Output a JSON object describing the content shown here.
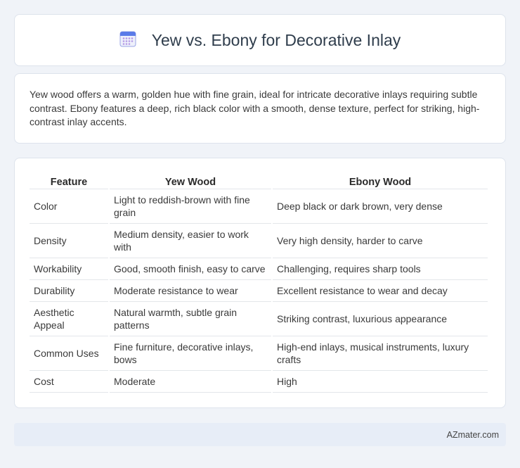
{
  "header": {
    "icon": "calendar-icon",
    "title": "Yew vs. Ebony for Decorative Inlay"
  },
  "intro": {
    "text": "Yew wood offers a warm, golden hue with fine grain, ideal for intricate decorative inlays requiring subtle contrast. Ebony features a deep, rich black color with a smooth, dense texture, perfect for striking, high-contrast inlay accents."
  },
  "table": {
    "headers": [
      "Feature",
      "Yew Wood",
      "Ebony Wood"
    ],
    "rows": [
      [
        "Color",
        "Light to reddish-brown with fine grain",
        "Deep black or dark brown, very dense"
      ],
      [
        "Density",
        "Medium density, easier to work with",
        "Very high density, harder to carve"
      ],
      [
        "Workability",
        "Good, smooth finish, easy to carve",
        "Challenging, requires sharp tools"
      ],
      [
        "Durability",
        "Moderate resistance to wear",
        "Excellent resistance to wear and decay"
      ],
      [
        "Aesthetic Appeal",
        "Natural warmth, subtle grain patterns",
        "Striking contrast, luxurious appearance"
      ],
      [
        "Common Uses",
        "Fine furniture, decorative inlays, bows",
        "High-end inlays, musical instruments, luxury crafts"
      ],
      [
        "Cost",
        "Moderate",
        "High"
      ]
    ]
  },
  "footer": {
    "brand": "AZmater.com"
  },
  "colors": {
    "page_bg": "#f0f3f8",
    "card_bg": "#ffffff",
    "footer_bg": "#e7edf7",
    "title_text": "#2f3d4c"
  }
}
